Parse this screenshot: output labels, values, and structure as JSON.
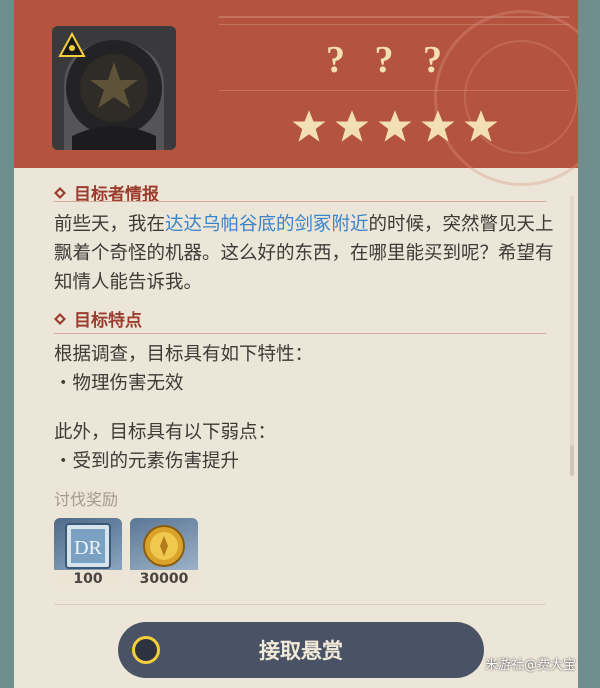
{
  "header": {
    "title": "? ? ?",
    "stars": 5,
    "star_color": "#f2dfb4",
    "bg_color": "#b4533f"
  },
  "section_info": {
    "heading": "目标者情报",
    "text_before": "前些天，我在",
    "text_highlight": "达达乌帕谷底的剑冢附近",
    "text_after": "的时候，突然瞥见天上飘着个奇怪的机器。这么好的东西，在哪里能买到呢？希望有知情人能告诉我。",
    "highlight_color": "#3b84c9"
  },
  "section_traits": {
    "heading": "目标特点",
    "line1": "根据调查，目标具有如下特性：",
    "line2": "・物理伤害无效",
    "line3": "此外，目标具有以下弱点：",
    "line4": "・受到的元素伤害提升"
  },
  "rewards": {
    "label": "讨伐奖励",
    "items": [
      {
        "icon": "card-icon",
        "count": "100"
      },
      {
        "icon": "mora-coin-icon",
        "count": "30000"
      }
    ]
  },
  "action": {
    "accept_label": "接取悬赏",
    "ring_color": "#f5cf3b"
  },
  "watermark": "米游社@费大宝"
}
